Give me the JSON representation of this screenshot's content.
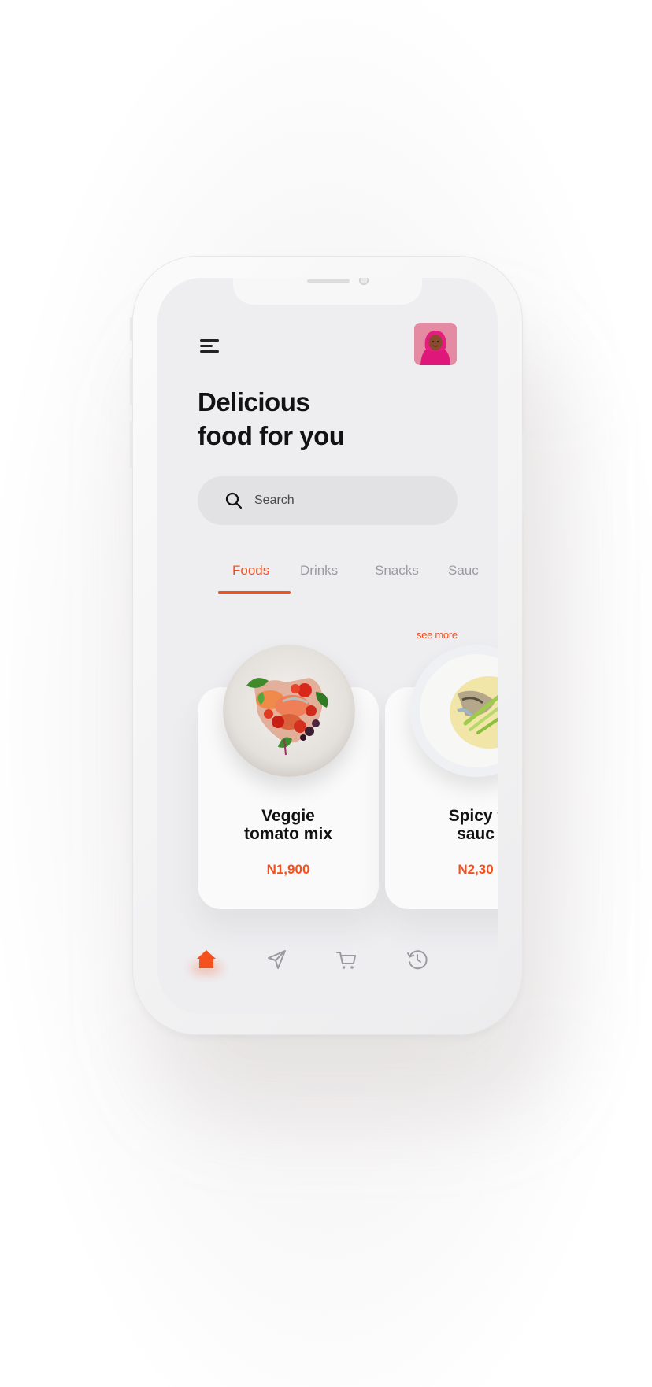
{
  "header": {
    "title_line1": "Delicious",
    "title_line2": "food for you"
  },
  "search": {
    "placeholder": "Search",
    "value": ""
  },
  "tabs": [
    {
      "label": "Foods",
      "active": true
    },
    {
      "label": "Drinks",
      "active": false
    },
    {
      "label": "Snacks",
      "active": false
    },
    {
      "label": "Sauc",
      "active": false
    }
  ],
  "see_more": "see more",
  "products": [
    {
      "name": "Veggie\ntomato mix",
      "price": "N1,900"
    },
    {
      "name": "Spicy f\nsauc",
      "price": "N2,30"
    }
  ],
  "bottom_nav": {
    "items": [
      "home-icon",
      "send-icon",
      "cart-icon",
      "history-icon"
    ],
    "active": "home-icon"
  },
  "colors": {
    "accent": "#f4511e",
    "screen_bg": "#eeeef1",
    "card_bg": "#fafafa",
    "inactive": "#9a9a9f"
  }
}
